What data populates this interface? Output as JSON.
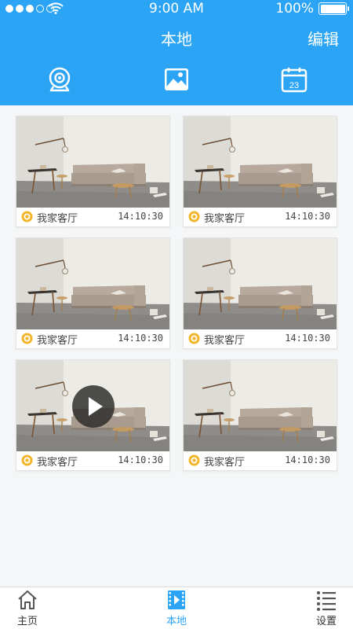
{
  "status_bar": {
    "time": "9:00 AM",
    "battery": "100%"
  },
  "header": {
    "title": "本地",
    "edit_label": "编辑"
  },
  "tabs": [
    {
      "icon": "camera-icon"
    },
    {
      "icon": "image-icon"
    },
    {
      "icon": "calendar-icon",
      "day": "23"
    }
  ],
  "videos": [
    {
      "label": "我家客厅",
      "time": "14:10:30"
    },
    {
      "label": "我家客厅",
      "time": "14:10:30"
    },
    {
      "label": "我家客厅",
      "time": "14:10:30"
    },
    {
      "label": "我家客厅",
      "time": "14:10:30"
    },
    {
      "label": "我家客厅",
      "time": "14:10:30"
    },
    {
      "label": "我家客厅",
      "time": "14:10:30"
    }
  ],
  "bottom_nav": [
    {
      "label": "主页",
      "icon": "home-icon"
    },
    {
      "label": "本地",
      "icon": "film-icon",
      "active": true
    },
    {
      "label": "设置",
      "icon": "list-icon"
    }
  ],
  "colors": {
    "primary": "#2ba4f5",
    "badge": "#f3b62a"
  }
}
